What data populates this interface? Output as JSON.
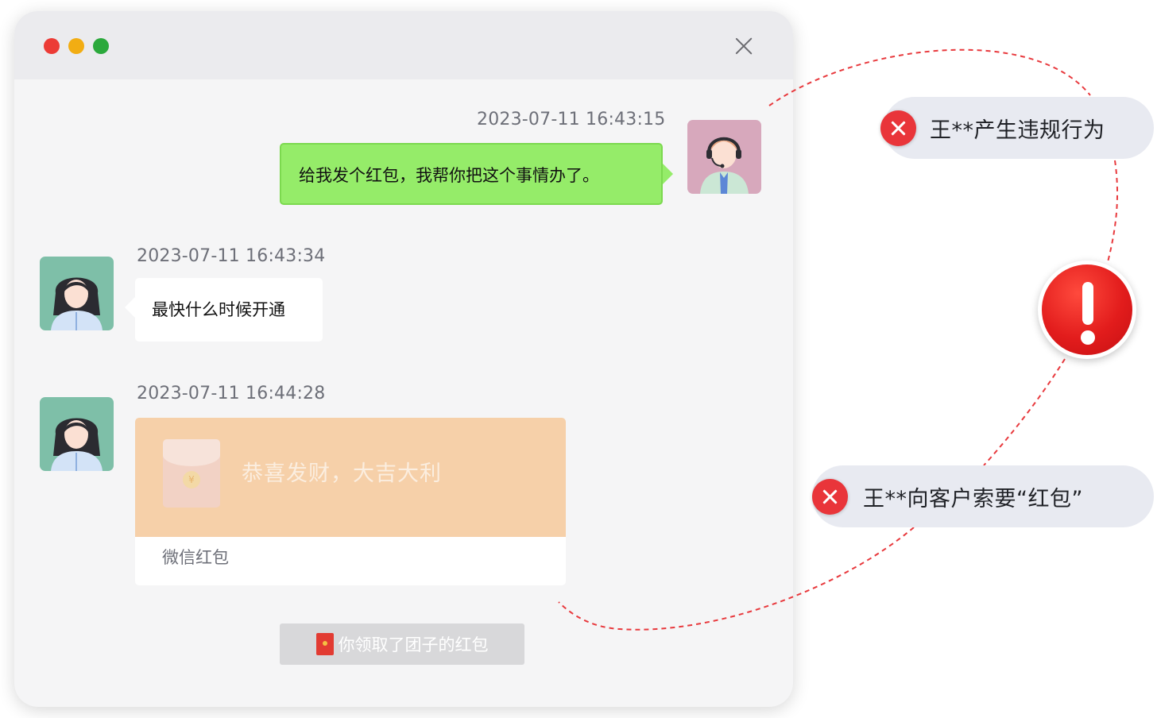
{
  "window": {
    "traffic_lights": [
      "red",
      "yellow",
      "green"
    ],
    "close_icon": "close-icon"
  },
  "messages": [
    {
      "side": "right",
      "timestamp": "2023-07-11 16:43:15",
      "text": "给我发个红包，我帮你把这个事情办了。",
      "avatar": "agent-avatar"
    },
    {
      "side": "left",
      "timestamp": "2023-07-11 16:43:34",
      "text": "最快什么时候开通",
      "avatar": "customer-avatar"
    },
    {
      "side": "left",
      "timestamp": "2023-07-11 16:44:28",
      "avatar": "customer-avatar",
      "red_packet": {
        "greeting": "恭喜发财，大吉大利",
        "footer": "微信红包"
      }
    }
  ],
  "system_message": "你领取了团子的红包",
  "alerts": [
    {
      "text": "王**产生违规行为",
      "icon": "x-circle-icon"
    },
    {
      "text": "王**向客户索要“红包”",
      "icon": "x-circle-icon"
    }
  ],
  "warning_icon": "exclamation-icon",
  "colors": {
    "bubble_self": "#95ec69",
    "red_packet": "#f6d0a9",
    "alert_red": "#e9353a",
    "connector": "#e8393d"
  }
}
